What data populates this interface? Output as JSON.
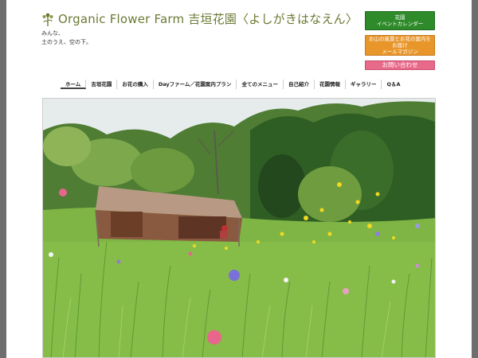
{
  "header": {
    "site_title": "Organic Flower Farm 吉垣花園〈よしがきはなえん〉",
    "tagline_line1": "みんな、",
    "tagline_line2": "土のうえ、空の下。"
  },
  "side_buttons": {
    "calendar_line1": "花園",
    "calendar_line2": "イベントカレンダー",
    "mail_line1": "お山の風景とお花の案内を",
    "mail_line2": "お届け",
    "mail_line3": "メールマガジン",
    "contact": "お問い合わせ"
  },
  "nav": {
    "items": [
      {
        "label": "ホーム"
      },
      {
        "label": "吉垣花園"
      },
      {
        "label": "お花の購入"
      },
      {
        "label": "Dayファーム／花園案内プラン"
      },
      {
        "label": "全てのメニュー"
      },
      {
        "label": "自己紹介"
      },
      {
        "label": "花園情報"
      },
      {
        "label": "ギャラリー"
      },
      {
        "label": "Q＆A"
      }
    ]
  },
  "colors": {
    "title": "#6b7a34",
    "calendar_button": "#2f8b2a",
    "mail_button": "#e8962a",
    "contact_button": "#e86a8a"
  }
}
